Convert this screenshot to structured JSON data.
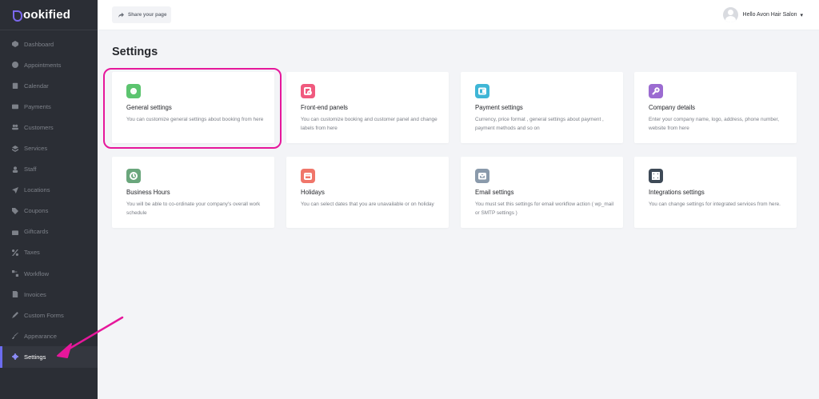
{
  "brand": {
    "logo_text": "ookified",
    "accent": "#7b68ee"
  },
  "sidebar": {
    "items": [
      {
        "label": "Dashboard",
        "icon": "dashboard-icon"
      },
      {
        "label": "Appointments",
        "icon": "clock-icon"
      },
      {
        "label": "Calendar",
        "icon": "calendar-icon"
      },
      {
        "label": "Payments",
        "icon": "wallet-icon"
      },
      {
        "label": "Customers",
        "icon": "users-icon"
      },
      {
        "label": "Services",
        "icon": "layers-icon"
      },
      {
        "label": "Staff",
        "icon": "user-icon"
      },
      {
        "label": "Locations",
        "icon": "location-arrow-icon"
      },
      {
        "label": "Coupons",
        "icon": "tag-icon"
      },
      {
        "label": "Giftcards",
        "icon": "gift-icon"
      },
      {
        "label": "Taxes",
        "icon": "percent-icon"
      },
      {
        "label": "Workflow",
        "icon": "workflow-icon"
      },
      {
        "label": "Invoices",
        "icon": "invoice-icon"
      },
      {
        "label": "Custom Forms",
        "icon": "form-icon"
      },
      {
        "label": "Appearance",
        "icon": "brush-icon"
      },
      {
        "label": "Settings",
        "icon": "gear-icon",
        "active": true
      }
    ]
  },
  "header": {
    "share_label": "Share your page",
    "user_greeting": "Hello Avon Hair Salon"
  },
  "main": {
    "title": "Settings",
    "cards": [
      {
        "title": "General settings",
        "desc": "You can customize general settings about booking from here",
        "icon": "gear-icon",
        "color": "#5cc46f"
      },
      {
        "title": "Front-end panels",
        "desc": "You can customize booking and customer panel and change labels from here",
        "icon": "panel-icon",
        "color": "#f05a7e"
      },
      {
        "title": "Payment settings",
        "desc": "Currency, price format , general settings about payment , payment methods and so on",
        "icon": "wallet-icon",
        "color": "#3fb6d6"
      },
      {
        "title": "Company details",
        "desc": "Enter your company name, logo, address, phone number, website from here",
        "icon": "key-icon",
        "color": "#9b6bd1"
      },
      {
        "title": "Business Hours",
        "desc": "You will be able to co-ordinate your company's overall work schedule",
        "icon": "clock-icon",
        "color": "#6aa67c"
      },
      {
        "title": "Holidays",
        "desc": "You can select dates that you are unavailable or on holiday",
        "icon": "calendar-icon",
        "color": "#f0766a"
      },
      {
        "title": "Email settings",
        "desc": "You must set this settings for email workflow action ( wp_mail or SMTP settings )",
        "icon": "mail-icon",
        "color": "#8a9aab"
      },
      {
        "title": "Integrations settings",
        "desc": "You can change settings for integrated services from here.",
        "icon": "grid-icon",
        "color": "#3e4a57"
      }
    ]
  },
  "annotation": {
    "highlight_color": "#e6179b"
  }
}
